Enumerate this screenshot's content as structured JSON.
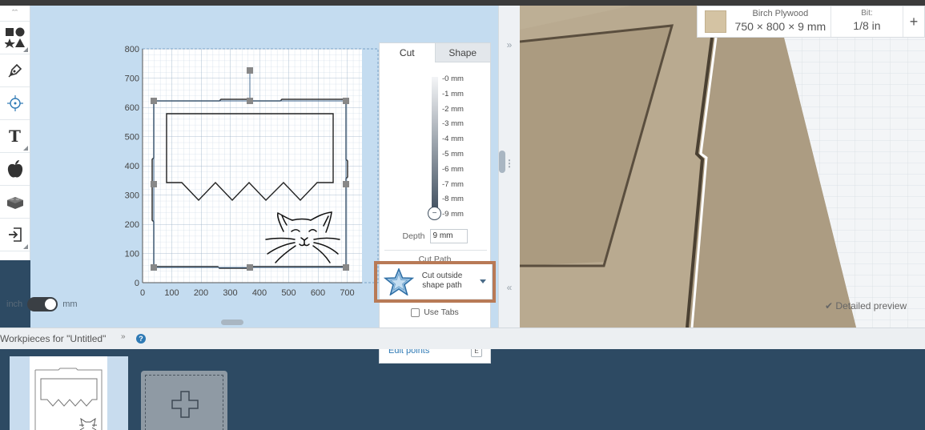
{
  "toolbar": {
    "tools": [
      {
        "name": "collapse-up",
        "icon": "double-chevron-up-icon"
      },
      {
        "name": "shapes",
        "icon": "shapes-icon"
      },
      {
        "name": "pen",
        "icon": "pen-icon"
      },
      {
        "name": "point",
        "icon": "crosshair-icon"
      },
      {
        "name": "text",
        "icon": "text-icon",
        "glyph": "T"
      },
      {
        "name": "icon-library",
        "icon": "apple-icon"
      },
      {
        "name": "apps",
        "icon": "brick-icon"
      },
      {
        "name": "import",
        "icon": "import-icon"
      }
    ]
  },
  "design": {
    "y_ticks": [
      "800",
      "700",
      "600",
      "500",
      "400",
      "300",
      "200",
      "100",
      "0"
    ],
    "x_ticks": [
      "0",
      "100",
      "200",
      "300",
      "400",
      "500",
      "600",
      "700"
    ],
    "unit_left": "inch",
    "unit_right": "mm",
    "unit_selected": "mm"
  },
  "cut_panel": {
    "tabs": [
      "Cut",
      "Shape"
    ],
    "active_tab": "Cut",
    "depth_labels": [
      "-0 mm",
      "-1 mm",
      "-2 mm",
      "-3 mm",
      "-4 mm",
      "-5 mm",
      "-6 mm",
      "-7 mm",
      "-8 mm",
      "-9 mm"
    ],
    "depth_label": "Depth",
    "depth_value": "9 mm",
    "cut_path_label": "Cut Path",
    "cut_path_option": "Cut outside shape path",
    "use_tabs_label": "Use Tabs",
    "use_tabs_checked": false,
    "edit_points_label": "Edit points",
    "edit_points_shortcut": "E"
  },
  "material": {
    "name": "Birch Plywood",
    "dimensions": "750 × 800 × 9 mm",
    "bit_label": "Bit:",
    "bit_value": "1/8 in",
    "add": "+"
  },
  "preview": {
    "detailed_preview_label": "Detailed preview",
    "checked": true
  },
  "workpieces": {
    "title": "Workpieces for \"Untitled\"",
    "caret": "»",
    "help": "?"
  },
  "colors": {
    "accent": "#2f7ab5",
    "highlight": "#b87a56",
    "canvas_bg": "#c4dcf0",
    "bottom_bg": "#2d4a63",
    "wood": "#b5a58c"
  }
}
